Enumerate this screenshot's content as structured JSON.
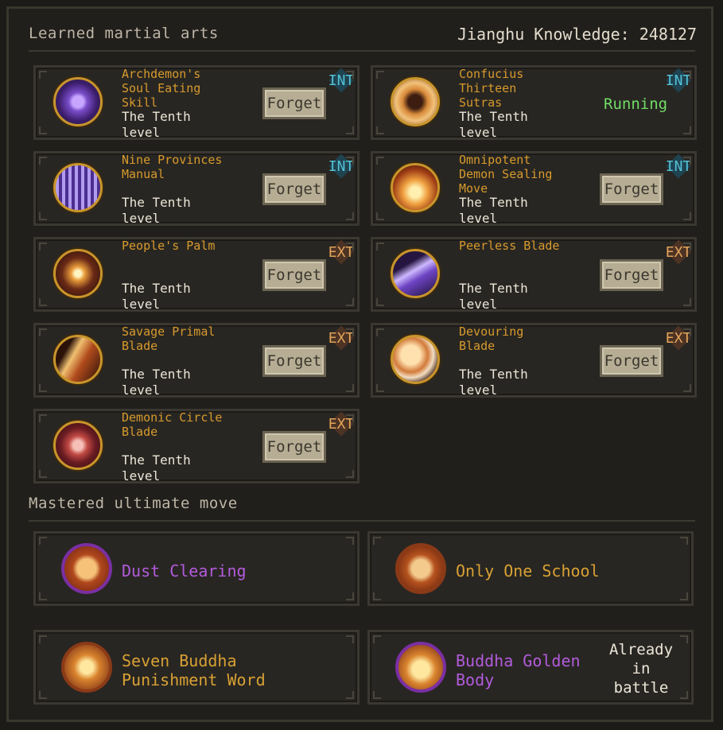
{
  "header": {
    "learned_title": "Learned martial arts",
    "knowledge_label": "Jianghu Knowledge: ",
    "knowledge_value": "248127",
    "ultimate_title": "Mastered ultimate move"
  },
  "skills": [
    {
      "name": "Archdemon's Soul Eating Skill",
      "level": "The Tenth level",
      "tag": "INT",
      "action": "Forget",
      "icon": "purple-vortex-icon"
    },
    {
      "name": "Confucius Thirteen Sutras",
      "level": "The Tenth level",
      "tag": "INT",
      "status": "Running",
      "icon": "meditating-sage-icon"
    },
    {
      "name": "Nine Provinces Manual",
      "level": "The Tenth level",
      "tag": "INT",
      "action": "Forget",
      "icon": "violet-pillars-icon"
    },
    {
      "name": "Omnipotent Demon Sealing Move",
      "level": "The Tenth level",
      "tag": "INT",
      "action": "Forget",
      "icon": "flame-seal-icon"
    },
    {
      "name": "People's Palm",
      "level": "The Tenth level",
      "tag": "EXT",
      "action": "Forget",
      "icon": "burst-palm-icon"
    },
    {
      "name": "Peerless Blade",
      "level": "The Tenth level",
      "tag": "EXT",
      "action": "Forget",
      "icon": "purple-slash-icon"
    },
    {
      "name": "Savage Primal Blade",
      "level": "The Tenth level",
      "tag": "EXT",
      "action": "Forget",
      "icon": "flaming-blade-icon"
    },
    {
      "name": "Devouring Blade",
      "level": "The Tenth level",
      "tag": "EXT",
      "action": "Forget",
      "icon": "crescent-blade-icon"
    },
    {
      "name": "Demonic Circle Blade",
      "level": "The Tenth level",
      "tag": "EXT",
      "action": "Forget",
      "icon": "red-spiral-icon"
    }
  ],
  "ultimates": [
    {
      "name": "Dust Clearing",
      "color": "#b25bdc",
      "ring": "#7b2fa3",
      "icon": "wave-crest-icon"
    },
    {
      "name": "Only One School",
      "color": "#d9a134",
      "ring": "#8a3a17",
      "icon": "scroll-crest-icon"
    },
    {
      "name": "Seven Buddha Punishment Word",
      "color": "#d9a134",
      "ring": "#8a3a17",
      "icon": "sun-crest-icon"
    },
    {
      "name": "Buddha Golden Body",
      "color": "#b25bdc",
      "ring": "#7b2fa3",
      "icon": "lotus-crest-icon",
      "status": "Already in battle"
    }
  ],
  "colors": {
    "gold_text": "#d79a2d",
    "running_green": "#71dd66",
    "int_tag": "#54c1d8",
    "ext_tag": "#e2a45a"
  }
}
